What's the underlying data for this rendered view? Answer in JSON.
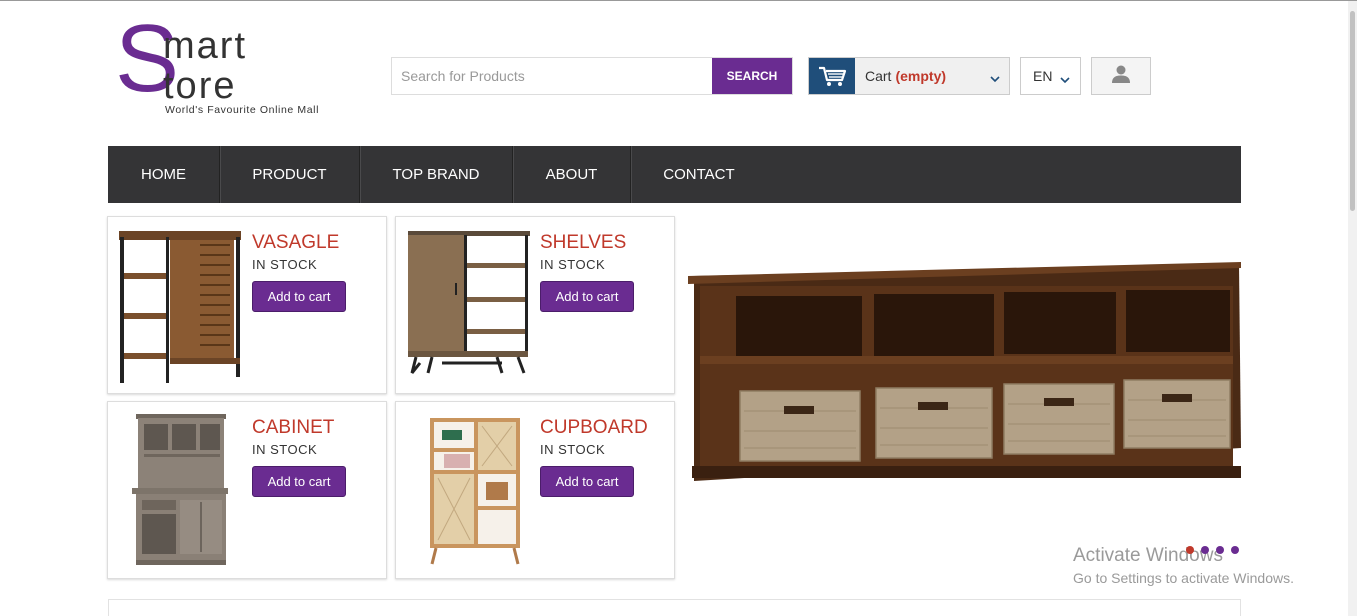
{
  "logo": {
    "s_letter": "S",
    "word1": "mart",
    "word2": "tore",
    "tagline": "World's Favourite Online Mall"
  },
  "search": {
    "placeholder": "Search for Products",
    "button": "SEARCH"
  },
  "cart": {
    "label": "Cart",
    "status": "(empty)"
  },
  "language": {
    "code": "EN"
  },
  "nav": {
    "items": [
      {
        "label": "HOME"
      },
      {
        "label": "PRODUCT"
      },
      {
        "label": "TOP BRAND"
      },
      {
        "label": "ABOUT"
      },
      {
        "label": "CONTACT"
      }
    ]
  },
  "products": [
    {
      "name": "VASAGLE",
      "stock": "IN STOCK",
      "button": "Add to cart"
    },
    {
      "name": "SHELVES",
      "stock": "IN STOCK",
      "button": "Add to cart"
    },
    {
      "name": "CABINET",
      "stock": "IN STOCK",
      "button": "Add to cart"
    },
    {
      "name": "CUPBOARD",
      "stock": "IN STOCK",
      "button": "Add to cart"
    }
  ],
  "slider": {
    "count": 4,
    "active_index": 0
  },
  "watermark": {
    "title": "Activate Windows",
    "subtitle": "Go to Settings to activate Windows."
  },
  "colors": {
    "brand": "#6a2c91",
    "accent_red": "#c0392b",
    "nav_bg": "#343436",
    "cart_icon_bg": "#1f4e7a"
  }
}
